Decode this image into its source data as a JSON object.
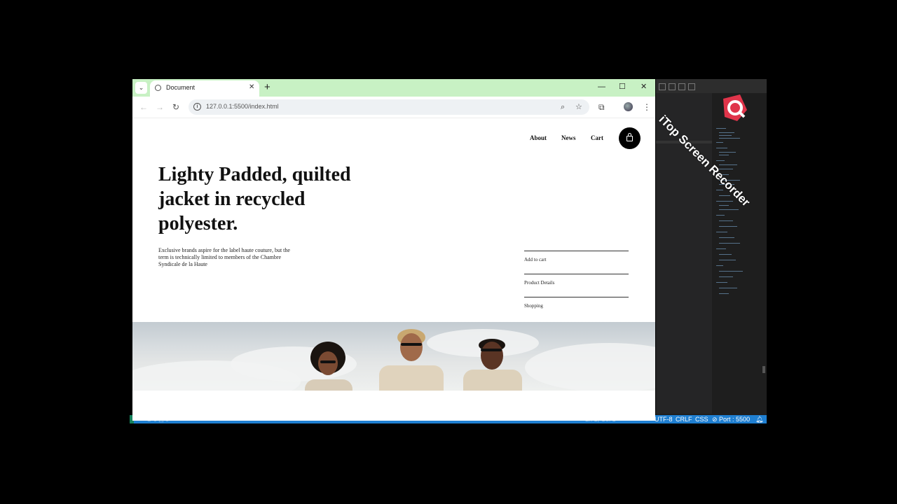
{
  "browser": {
    "tab": {
      "title": "Document",
      "favicon": "globe-icon",
      "close": "✕"
    },
    "new_tab": "+",
    "window_controls": {
      "minimize": "—",
      "maximize": "☐",
      "close": "✕"
    },
    "toolbar": {
      "url": "127.0.0.1:5500/index.html",
      "back": "←",
      "forward": "→",
      "reload": "↻"
    }
  },
  "page": {
    "nav": {
      "about": "About",
      "news": "News",
      "cart": "Cart"
    },
    "headline": "Lighty Padded, quilted jacket in recycled polyester.",
    "description": "Exclusive brands aspire for the label haute couture, but the term is technically limited to members of the Chambre Syndicale de la Haute",
    "actions": {
      "add_to_cart": "Add to cart",
      "product_details": "Product Details",
      "shopping": "Shopping"
    }
  },
  "vscode": {
    "watermark": "iTop Screen Recorder",
    "statusbar": {
      "encoding": "UTF-8",
      "eol": "CRLF",
      "language": "CSS",
      "port": "⊘ Port : 5500"
    }
  }
}
